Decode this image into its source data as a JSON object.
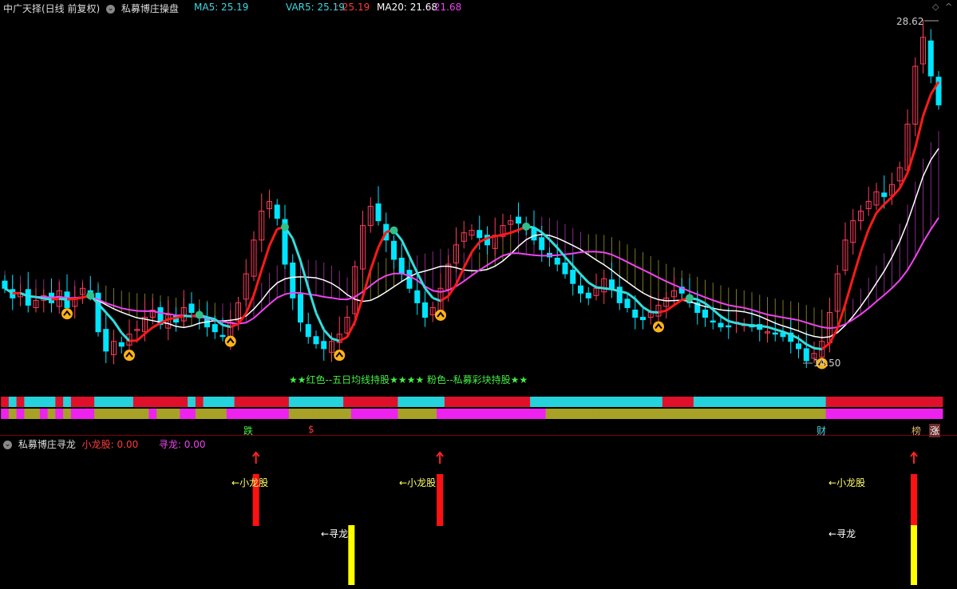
{
  "main_header": {
    "stock": "中广天择(日线 前复权)",
    "indicator": "私募博庄操盘",
    "ma5_label": "MA5: 25.19",
    "var5_label": "VAR5: 25.19",
    "var5_value": ": 25.19",
    "ma20_label": "MA20: 21.68",
    "ma20_value": ": 21.68"
  },
  "sub_header": {
    "indicator": "私募博庄寻龙",
    "xiaolong_label": "小龙股: 0.00",
    "xunlong_label": "寻龙: 0.00"
  },
  "annotations": {
    "high": "28.62",
    "low": "14.50",
    "legend_text": "★★红色--五日均线持股★★★★ 粉色--私募彩块持股★★",
    "markers": [
      "跌",
      "$",
      "财",
      "榜",
      "涨"
    ],
    "xiaolong_tag": "小龙股",
    "xunlong_tag": "寻龙"
  },
  "colors": {
    "up": "#ff3b5c",
    "down": "#00e5ff",
    "ma5": "#ff1a1a",
    "ma5_cyan": "#33dddd",
    "ma20": "#ee44ee",
    "white_line": "#ffffff",
    "yellow": "#ffff00",
    "green": "#44ee44",
    "olive": "#a7a127"
  },
  "chart_data": [
    {
      "type": "candlestick",
      "title": "私募博庄操盘",
      "price_high": 28.62,
      "price_low": 14.5,
      "close": [
        17.6,
        17.2,
        17.4,
        16.9,
        17.1,
        17.3,
        17.0,
        17.5,
        16.8,
        17.2,
        17.6,
        17.4,
        15.8,
        15.0,
        15.4,
        15.2,
        15.7,
        15.9,
        16.4,
        16.7,
        16.1,
        16.5,
        16.2,
        16.8,
        16.6,
        16.4,
        16.0,
        15.8,
        15.6,
        16.2,
        17.0,
        18.2,
        19.6,
        20.8,
        21.2,
        20.5,
        18.6,
        17.2,
        16.2,
        15.6,
        15.3,
        15.1,
        15.4,
        15.7,
        16.4,
        18.5,
        20.2,
        21.0,
        20.4,
        19.6,
        18.8,
        18.2,
        17.6,
        17.0,
        16.4,
        16.8,
        17.6,
        18.6,
        19.4,
        19.9,
        20.0,
        19.7,
        19.4,
        19.8,
        20.2,
        20.4,
        20.3,
        20.1,
        19.6,
        19.2,
        18.9,
        18.6,
        18.2,
        17.8,
        17.4,
        17.2,
        17.6,
        18.0,
        17.6,
        17.0,
        16.8,
        16.4,
        16.3,
        16.6,
        16.9,
        17.2,
        17.5,
        17.4,
        17.0,
        16.6,
        16.4,
        16.2,
        16.0,
        16.0,
        16.2,
        16.1,
        16.0,
        15.9,
        15.8,
        15.7,
        15.6,
        15.4,
        15.1,
        14.6,
        14.9,
        15.4,
        16.6,
        18.2,
        19.6,
        20.4,
        20.8,
        21.2,
        21.6,
        21.4,
        21.9,
        22.6,
        24.4,
        26.8,
        28.0,
        26.4,
        25.2
      ],
      "ma5_last": 25.19,
      "var5_last": 25.19,
      "ma20_last": 21.68
    },
    {
      "type": "bar",
      "title": "私募博庄寻龙",
      "series": [
        {
          "name": "小龙股",
          "value": 0.0,
          "signals_at": [
            71,
            123,
            257
          ]
        },
        {
          "name": "寻龙",
          "value": 0.0,
          "signals_at": [
            98,
            257
          ]
        }
      ]
    }
  ]
}
